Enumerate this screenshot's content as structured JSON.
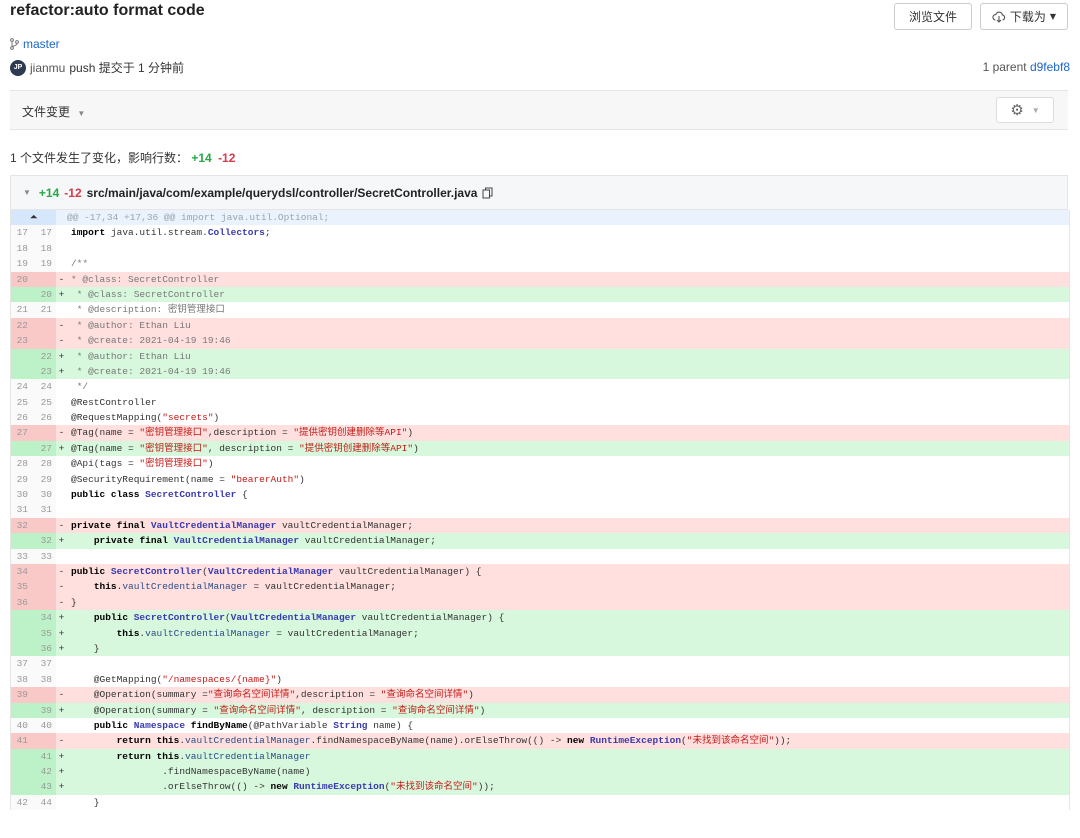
{
  "commit": {
    "title": "refactor:auto format code",
    "branch": "master",
    "avatar_initials": "JP",
    "author": "jianmu",
    "push_text": " push 提交于 1 分钟前",
    "parent_label": "1 parent",
    "parent_hash": "d9febf8"
  },
  "toolbar": {
    "browse_label": "浏览文件",
    "download_label": "下载为"
  },
  "changes": {
    "label": "文件变更",
    "summary_prefix": "1 个文件发生了变化，影响行数：",
    "additions": "+14",
    "deletions": "-12"
  },
  "file": {
    "additions": "+14",
    "deletions": "-12",
    "path": "src/main/java/com/example/querydsl/controller/SecretController.java"
  },
  "hunk_header": "@@ -17,34 +17,36 @@ import java.util.Optional;",
  "diff_lines": [
    {
      "type": "ctx",
      "old": "17",
      "new": "17",
      "text": "import java.util.stream.Collectors;"
    },
    {
      "type": "ctx",
      "old": "18",
      "new": "18",
      "text": ""
    },
    {
      "type": "ctx",
      "old": "19",
      "new": "19",
      "text": "/**"
    },
    {
      "type": "del",
      "old": "20",
      "new": "",
      "text": "* @class: SecretController"
    },
    {
      "type": "add",
      "old": "",
      "new": "20",
      "text": " * @class: SecretController"
    },
    {
      "type": "ctx",
      "old": "21",
      "new": "21",
      "text": " * @description: 密钥管理接口"
    },
    {
      "type": "del",
      "old": "22",
      "new": "",
      "text": " * @author: Ethan Liu"
    },
    {
      "type": "del",
      "old": "23",
      "new": "",
      "text": " * @create: 2021-04-19 19:46"
    },
    {
      "type": "add",
      "old": "",
      "new": "22",
      "text": " * @author: Ethan Liu"
    },
    {
      "type": "add",
      "old": "",
      "new": "23",
      "text": " * @create: 2021-04-19 19:46"
    },
    {
      "type": "ctx",
      "old": "24",
      "new": "24",
      "text": " */"
    },
    {
      "type": "ctx",
      "old": "25",
      "new": "25",
      "text": "@RestController"
    },
    {
      "type": "ctx",
      "old": "26",
      "new": "26",
      "text": "@RequestMapping(\"secrets\")"
    },
    {
      "type": "del",
      "old": "27",
      "new": "",
      "text": "@Tag(name = \"密钥管理接口\",description = \"提供密钥创建删除等API\")"
    },
    {
      "type": "add",
      "old": "",
      "new": "27",
      "text": "@Tag(name = \"密钥管理接口\", description = \"提供密钥创建删除等API\")"
    },
    {
      "type": "ctx",
      "old": "28",
      "new": "28",
      "text": "@Api(tags = \"密钥管理接口\")"
    },
    {
      "type": "ctx",
      "old": "29",
      "new": "29",
      "text": "@SecurityRequirement(name = \"bearerAuth\")"
    },
    {
      "type": "ctx",
      "old": "30",
      "new": "30",
      "text": "public class SecretController {"
    },
    {
      "type": "ctx",
      "old": "31",
      "new": "31",
      "text": ""
    },
    {
      "type": "del",
      "old": "32",
      "new": "",
      "text": "private final VaultCredentialManager vaultCredentialManager;"
    },
    {
      "type": "add",
      "old": "",
      "new": "32",
      "text": "    private final VaultCredentialManager vaultCredentialManager;"
    },
    {
      "type": "ctx",
      "old": "33",
      "new": "33",
      "text": ""
    },
    {
      "type": "del",
      "old": "34",
      "new": "",
      "text": "public SecretController(VaultCredentialManager vaultCredentialManager) {"
    },
    {
      "type": "del",
      "old": "35",
      "new": "",
      "text": "    this.vaultCredentialManager = vaultCredentialManager;"
    },
    {
      "type": "del",
      "old": "36",
      "new": "",
      "text": "}"
    },
    {
      "type": "add",
      "old": "",
      "new": "34",
      "text": "    public SecretController(VaultCredentialManager vaultCredentialManager) {"
    },
    {
      "type": "add",
      "old": "",
      "new": "35",
      "text": "        this.vaultCredentialManager = vaultCredentialManager;"
    },
    {
      "type": "add",
      "old": "",
      "new": "36",
      "text": "    }"
    },
    {
      "type": "ctx",
      "old": "37",
      "new": "37",
      "text": ""
    },
    {
      "type": "ctx",
      "old": "38",
      "new": "38",
      "text": "    @GetMapping(\"/namespaces/{name}\")"
    },
    {
      "type": "del",
      "old": "39",
      "new": "",
      "text": "    @Operation(summary =\"查询命名空间详情\",description = \"查询命名空间详情\")"
    },
    {
      "type": "add",
      "old": "",
      "new": "39",
      "text": "    @Operation(summary = \"查询命名空间详情\", description = \"查询命名空间详情\")"
    },
    {
      "type": "ctx",
      "old": "40",
      "new": "40",
      "text": "    public Namespace findByName(@PathVariable String name) {"
    },
    {
      "type": "del",
      "old": "41",
      "new": "",
      "text": "        return this.vaultCredentialManager.findNamespaceByName(name).orElseThrow(() -> new RuntimeException(\"未找到该命名空间\"));"
    },
    {
      "type": "add",
      "old": "",
      "new": "41",
      "text": "        return this.vaultCredentialManager"
    },
    {
      "type": "add",
      "old": "",
      "new": "42",
      "text": "                .findNamespaceByName(name)"
    },
    {
      "type": "add",
      "old": "",
      "new": "43",
      "text": "                .orElseThrow(() -> new RuntimeException(\"未找到该命名空间\"));"
    },
    {
      "type": "ctx",
      "old": "42",
      "new": "44",
      "text": "    }"
    }
  ]
}
